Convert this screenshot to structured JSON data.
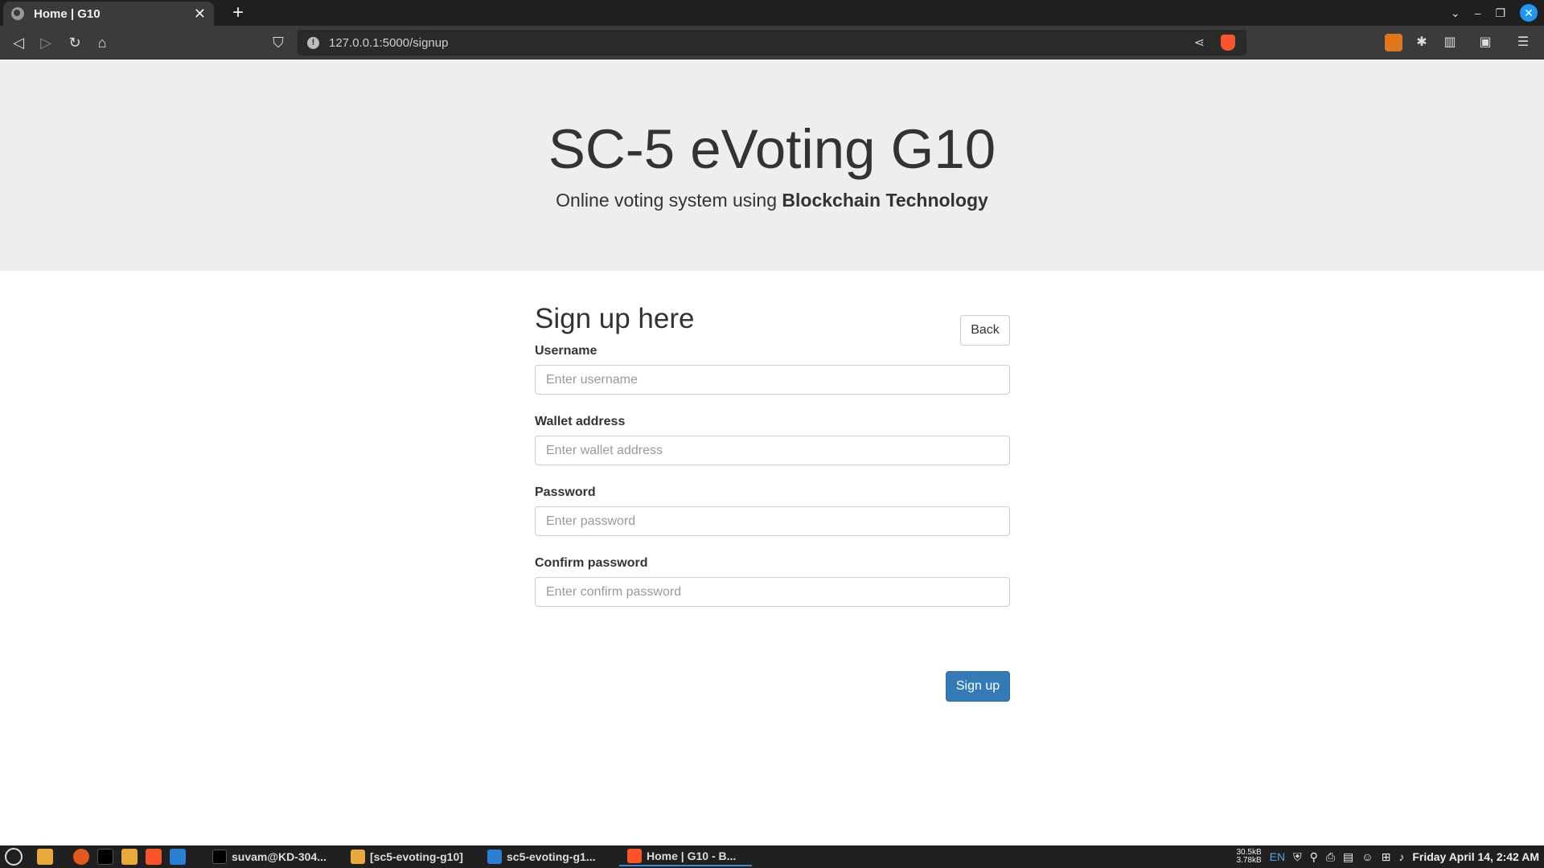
{
  "browser": {
    "tab_title": "Home | G10",
    "new_tab": "+",
    "url": "127.0.0.1:5000/signup"
  },
  "page": {
    "heading": "SC-5 eVoting G10",
    "lead_prefix": "Online voting system using ",
    "lead_bold": "Blockchain Technology"
  },
  "form": {
    "title": "Sign up here",
    "back_label": "Back",
    "fields": [
      {
        "label": "Username",
        "placeholder": "Enter username"
      },
      {
        "label": "Wallet address",
        "placeholder": "Enter wallet address"
      },
      {
        "label": "Password",
        "placeholder": "Enter password"
      },
      {
        "label": "Confirm password",
        "placeholder": "Enter confirm password"
      }
    ],
    "submit_label": "Sign up"
  },
  "taskbar": {
    "apps": [
      {
        "label": "suvam@KD-304..."
      },
      {
        "label": "[sc5-evoting-g10]"
      },
      {
        "label": "sc5-evoting-g1..."
      },
      {
        "label": "Home | G10 - B..."
      }
    ],
    "net_down": "30.5kB",
    "net_up": "3.78kB",
    "lang": "EN",
    "clock": "Friday April 14,  2:42 AM"
  },
  "colors": {
    "primary": "#337ab7",
    "jumbotron_bg": "#eeeeee",
    "taskbar_bg": "#202020"
  }
}
